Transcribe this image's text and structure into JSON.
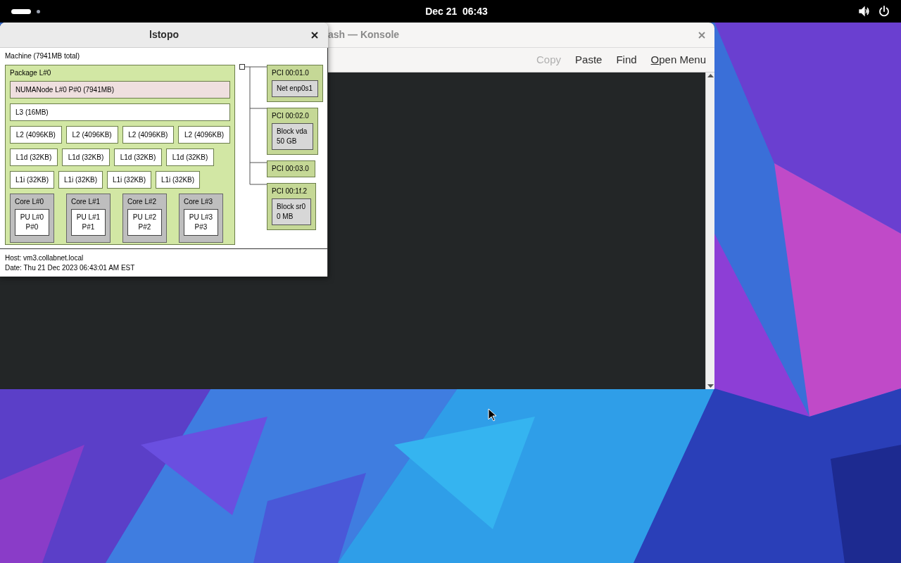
{
  "top_bar": {
    "clock": "Dec 21  06:43"
  },
  "konsole": {
    "title": "ash — Konsole",
    "toolbar": [
      {
        "label": "Copy",
        "disabled": true
      },
      {
        "label": "Paste",
        "disabled": false
      },
      {
        "label": "Find",
        "disabled": false
      },
      {
        "label": "Open Menu",
        "disabled": false,
        "mnemonic_underlined": true
      }
    ]
  },
  "lstopo": {
    "title": "lstopo",
    "machine": "Machine (7941MB total)",
    "package": "Package L#0",
    "numa": "NUMANode L#0 P#0 (7941MB)",
    "l3": "L3 (16MB)",
    "l2": [
      "L2 (4096KB)",
      "L2 (4096KB)",
      "L2 (4096KB)",
      "L2 (4096KB)"
    ],
    "l1d": [
      "L1d (32KB)",
      "L1d (32KB)",
      "L1d (32KB)",
      "L1d (32KB)"
    ],
    "l1i": [
      "L1i (32KB)",
      "L1i (32KB)",
      "L1i (32KB)",
      "L1i (32KB)"
    ],
    "cores": [
      {
        "label": "Core L#0",
        "pu": [
          "PU L#0",
          "P#0"
        ]
      },
      {
        "label": "Core L#1",
        "pu": [
          "PU L#1",
          "P#1"
        ]
      },
      {
        "label": "Core L#2",
        "pu": [
          "PU L#2",
          "P#2"
        ]
      },
      {
        "label": "Core L#3",
        "pu": [
          "PU L#3",
          "P#3"
        ]
      }
    ],
    "pci": [
      {
        "label": "PCI 00:01.0",
        "device": [
          "Net enp0s1"
        ]
      },
      {
        "label": "PCI 00:02.0",
        "device": [
          "Block vda",
          "50 GB"
        ]
      },
      {
        "label": "PCI 00:03.0"
      },
      {
        "label": "PCI 00:1f.2",
        "device": [
          "Block sr0",
          "0 MB"
        ]
      }
    ],
    "footer": [
      "Host: vm3.collabnet.local",
      "Date: Thu 21 Dec 2023 06:43:01 AM EST"
    ]
  }
}
